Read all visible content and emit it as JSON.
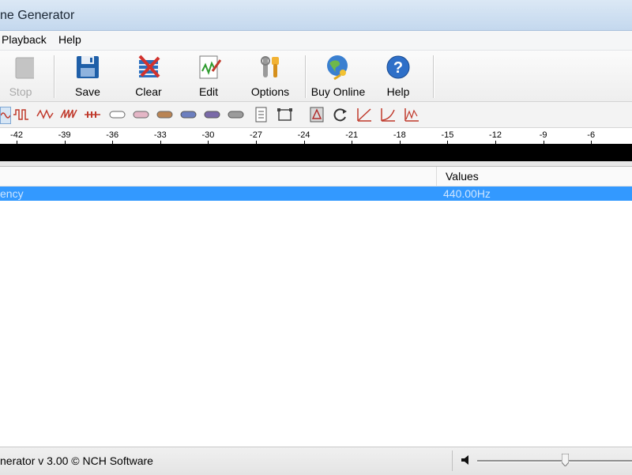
{
  "window": {
    "title": "ne Generator"
  },
  "menu": {
    "items": [
      "Playback",
      "Help"
    ]
  },
  "toolbar": {
    "stop_label": "Stop",
    "save_label": "Save",
    "clear_label": "Clear",
    "edit_label": "Edit",
    "options_label": "Options",
    "buy_label": "Buy Online",
    "help_label": "Help"
  },
  "ruler": {
    "ticks": [
      "-42",
      "-39",
      "-36",
      "-33",
      "-30",
      "-27",
      "-24",
      "-21",
      "-18",
      "-15",
      "-12",
      "-9",
      "-6"
    ]
  },
  "list": {
    "header_values": "Values",
    "rows": [
      {
        "name": "ency",
        "value": "440.00Hz"
      }
    ]
  },
  "status": {
    "text": "nerator v 3.00 © NCH Software",
    "volume_fraction": 0.57
  },
  "colors": {
    "selection": "#3399ff",
    "wave_bg": "#000000",
    "red_icon": "#c0392b"
  }
}
